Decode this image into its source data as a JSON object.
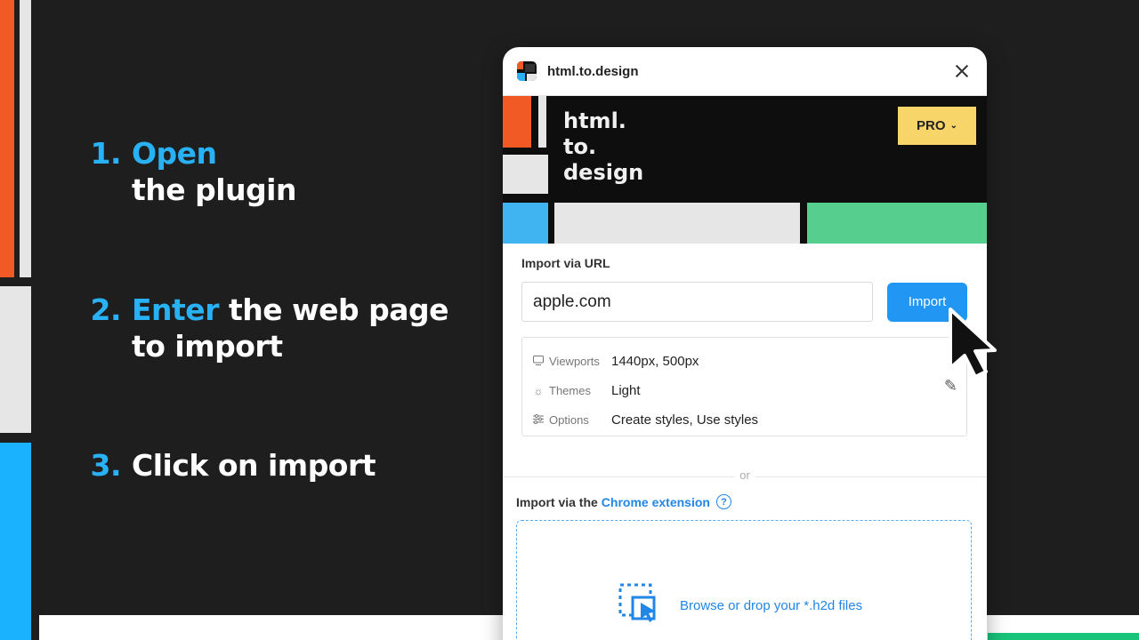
{
  "steps": [
    {
      "num": "1.",
      "highlight": "Open",
      "rest": "the plugin"
    },
    {
      "num": "2.",
      "highlight": "Enter",
      "rest_line1": " the web page",
      "rest_line2": "to import"
    },
    {
      "num": "3.",
      "text": "Click on import"
    }
  ],
  "plugin": {
    "title": "html.to.design",
    "banner_text": "html.\nto.\ndesign",
    "pro_label": "PRO",
    "import_url_label": "Import via URL",
    "url_value": "apple.com",
    "import_button": "Import",
    "settings": {
      "viewports_label": "Viewports",
      "viewports_value": "1440px, 500px",
      "themes_label": "Themes",
      "themes_value": "Light",
      "options_label": "Options",
      "options_value": "Create styles, Use styles"
    },
    "divider_text": "or",
    "chrome_prefix": "Import via the",
    "chrome_link": "Chrome extension",
    "help_glyph": "?",
    "drop_text": "Browse or drop your *.h2d files"
  },
  "colors": {
    "accent_blue": "#29b1f5",
    "button_blue": "#2196f3",
    "pro_yellow": "#f8d568",
    "orange": "#f15a24",
    "green": "#17c47a"
  },
  "icons": {
    "close": "close-icon",
    "monitor": "monitor-icon",
    "sun": "sun-icon",
    "sliders": "sliders-icon",
    "pencil": "pencil-icon",
    "help": "help-icon",
    "upload": "upload-select-icon",
    "cursor": "mouse-cursor-icon"
  }
}
